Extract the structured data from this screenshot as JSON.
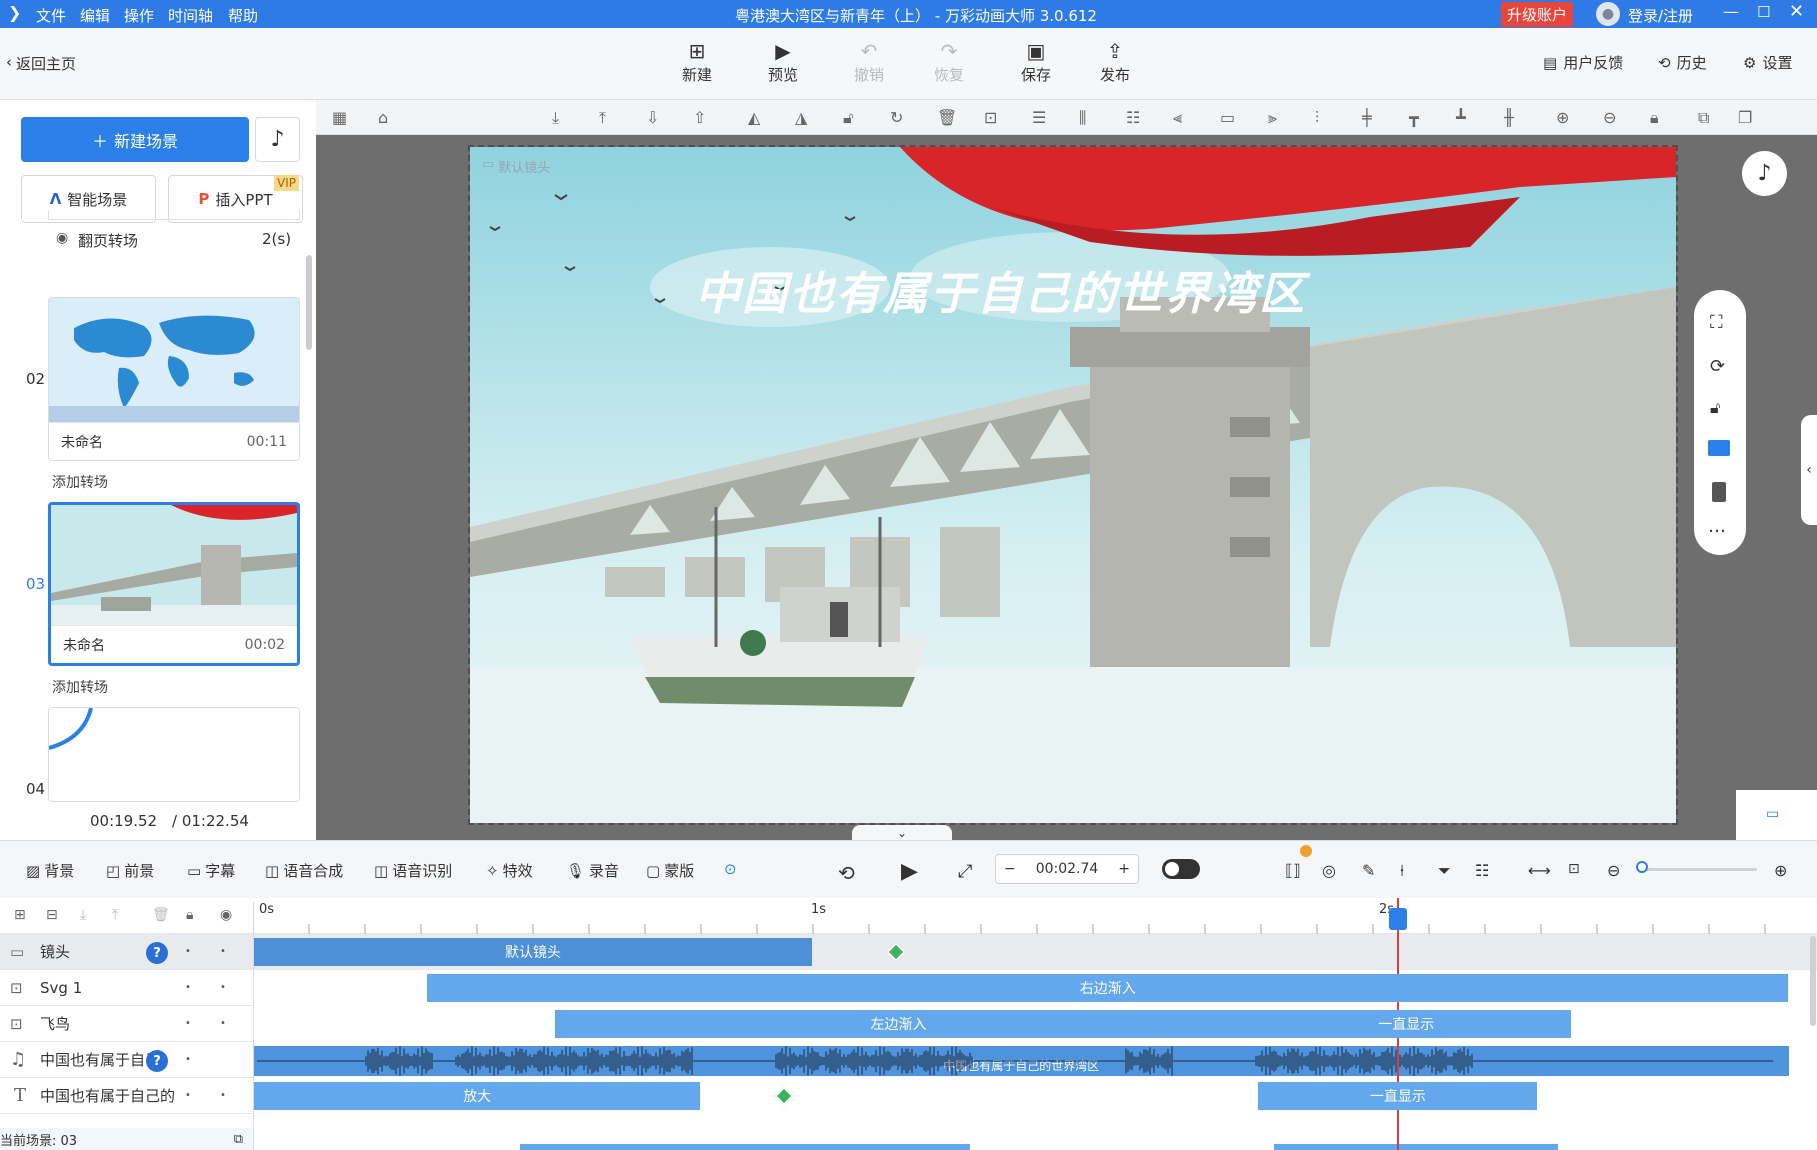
{
  "app": {
    "title": "粤港澳大湾区与新青年（上） - 万彩动画大师 3.0.612",
    "menu": [
      "文件",
      "编辑",
      "操作",
      "时间轴",
      "帮助"
    ],
    "upgrade": "升级账户",
    "login": "登录/注册",
    "window_controls": [
      "minimize-icon",
      "maximize-icon",
      "close-icon"
    ]
  },
  "toolbar": {
    "back": "返回主页",
    "buttons": [
      {
        "label": "新建",
        "icon": "plus-icon",
        "enabled": true
      },
      {
        "label": "预览",
        "icon": "play-icon",
        "enabled": true
      },
      {
        "label": "撤销",
        "icon": "undo-icon",
        "enabled": false
      },
      {
        "label": "恢复",
        "icon": "redo-icon",
        "enabled": false
      },
      {
        "label": "保存",
        "icon": "save-icon",
        "enabled": true
      },
      {
        "label": "发布",
        "icon": "publish-icon",
        "enabled": true
      }
    ],
    "right": [
      {
        "label": "用户反馈",
        "icon": "feedback-icon"
      },
      {
        "label": "历史",
        "icon": "history-icon"
      },
      {
        "label": "设置",
        "icon": "gear-icon"
      }
    ]
  },
  "left": {
    "new_scene": "新建场景",
    "smart_scene": "智能场景",
    "insert_ppt": "插入PPT",
    "vip": "VIP",
    "transition_label": "翻页转场",
    "transition_duration": "2(s)",
    "add_transition": "添加转场",
    "scenes": [
      {
        "num": "02",
        "name": "未命名",
        "time": "00:11",
        "selected": false
      },
      {
        "num": "03",
        "name": "未命名",
        "time": "00:02",
        "selected": true
      },
      {
        "num": "04",
        "name": "",
        "time": "",
        "selected": false
      }
    ],
    "current_time": "00:19.52",
    "total_time": "/ 01:22.54",
    "current_scene": "当前场景: 03"
  },
  "canvas": {
    "camera_label": "默认镜头",
    "headline": "中国也有属于自己的世界湾区",
    "thumb_world_label": "",
    "colors": {
      "sky": "#bfe5ea",
      "flag": "#d9252a",
      "bridge": "#b9bcb4"
    }
  },
  "tlcontrols": {
    "items": [
      {
        "label": "背景",
        "icon": "background-icon"
      },
      {
        "label": "前景",
        "icon": "foreground-icon"
      },
      {
        "label": "字幕",
        "icon": "subtitle-icon"
      },
      {
        "label": "语音合成",
        "icon": "tts-icon"
      },
      {
        "label": "语音识别",
        "icon": "asr-icon"
      },
      {
        "label": "特效",
        "icon": "effects-icon"
      },
      {
        "label": "录音",
        "icon": "mic-icon"
      },
      {
        "label": "蒙版",
        "icon": "mask-icon"
      }
    ],
    "time_value": "00:02.74",
    "minus": "−",
    "plus": "+"
  },
  "timeline": {
    "ruler": [
      "0s",
      "1s",
      "2s"
    ],
    "playhead_seconds": 2.05,
    "tracks": [
      {
        "name": "镜头",
        "icon": "camera-icon",
        "bars": [
          {
            "label": "默认镜头",
            "from": 0,
            "to": 1.0
          }
        ],
        "diamond": 1.08
      },
      {
        "name": "Svg 1",
        "icon": "svg-icon",
        "bars": [
          {
            "label": "右边渐入",
            "from": 0.31,
            "to": 2.75
          }
        ]
      },
      {
        "name": "飞鸟",
        "icon": "svg-icon",
        "bars": [
          {
            "label": "左边渐入",
            "from": 0.54,
            "to": 1.77
          },
          {
            "label": "一直显示",
            "from": 1.77,
            "to": 2.36
          }
        ]
      },
      {
        "name": "中国也有属于自己的",
        "icon": "music-icon",
        "bars": [
          {
            "label": "中国也有属于自己的世界湾区",
            "from": 0,
            "to": 2.75
          }
        ]
      },
      {
        "name": "中国也有属于自己的",
        "icon": "text-icon",
        "bars": [
          {
            "label": "放大",
            "from": 0,
            "to": 0.8
          },
          {
            "label": "一直显示",
            "from": 1.8,
            "to": 2.3
          }
        ],
        "diamond": 0.88
      }
    ]
  }
}
